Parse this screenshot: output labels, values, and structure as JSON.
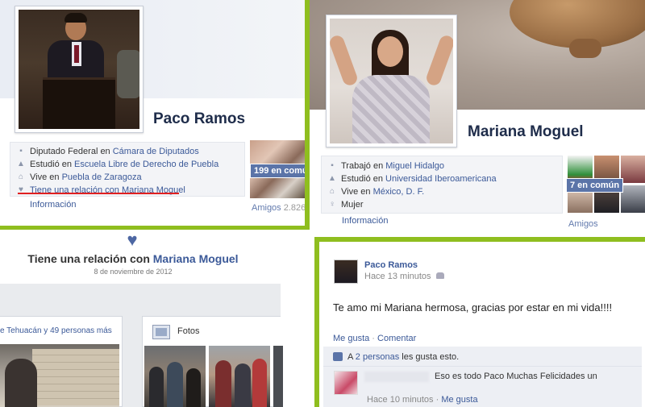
{
  "accent_colors": {
    "divider_green": "#8fbe1f",
    "link_blue": "#3b5998",
    "heart_blue": "#4d67a3",
    "badge_blue": "#5b74a8",
    "underline_red": "#e02020"
  },
  "paco_profile": {
    "name": "Paco Ramos",
    "details": [
      {
        "icon": "briefcase-icon",
        "prefix": "Diputado Federal en ",
        "link": "Cámara de Diputados"
      },
      {
        "icon": "graduation-icon",
        "prefix": "Estudió en ",
        "link": "Escuela Libre de Derecho de Puebla"
      },
      {
        "icon": "house-icon",
        "prefix": "Vive en ",
        "link": "Puebla de Zaragoza"
      },
      {
        "icon": "heart-icon",
        "prefix": "Tiene una relación con ",
        "link": "Mariana Moguel"
      }
    ],
    "info_link": "Información",
    "common_friends_badge": "199 en común",
    "friends_label": "Amigos",
    "friends_count": "2.826"
  },
  "mariana_profile": {
    "name": "Mariana Moguel",
    "details": [
      {
        "icon": "briefcase-icon",
        "prefix": "Trabajó en ",
        "link": "Miguel Hidalgo"
      },
      {
        "icon": "graduation-icon",
        "prefix": "Estudió en ",
        "link": "Universidad Iberoamericana"
      },
      {
        "icon": "house-icon",
        "prefix": "Vive en ",
        "link": "México, D. F."
      },
      {
        "icon": "gender-icon",
        "prefix": "Mujer",
        "link": ""
      }
    ],
    "info_link": "Información",
    "common_friends_badge": "7 en común",
    "friends_label": "Amigos"
  },
  "relationship_story": {
    "title_prefix": "Tiene una relación con ",
    "title_link": "Mariana Moguel",
    "date": "8 de noviembre de 2012",
    "tagged_text": "e Tehuacán y 49 personas más",
    "photos_label": "Fotos"
  },
  "post": {
    "author": "Paco Ramos",
    "time": "Hace 13 minutos",
    "message": "Te amo mi Mariana hermosa, gracias por estar en mi vida!!!!",
    "like_action": "Me gusta",
    "separator": " · ",
    "comment_action": "Comentar",
    "likes_prefix": "A ",
    "likes_link": "2 personas",
    "likes_suffix": " les gusta esto.",
    "comment_text": "Eso es todo Paco Muchas Felicidades un",
    "comment_time": "Hace 10 minutos",
    "comment_like": "Me gusta"
  }
}
